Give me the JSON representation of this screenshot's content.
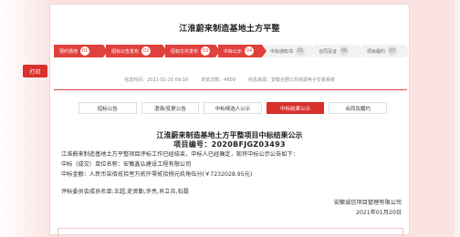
{
  "float_print_label": "打印",
  "page": {
    "title": "江淮蔚来制造基地土方平整"
  },
  "steps": [
    {
      "label": "预约场地",
      "num": "01",
      "state": "done"
    },
    {
      "label": "招标公告发布",
      "num": "02",
      "state": "done"
    },
    {
      "label": "招标文件发布",
      "num": "03",
      "state": "done"
    },
    {
      "label": "中标公示",
      "num": "04",
      "state": "done"
    },
    {
      "label": "中标通知书",
      "num": "05",
      "state": "todo"
    },
    {
      "label": "合同及证",
      "num": "06",
      "state": "todo"
    },
    {
      "label": "项目履约",
      "num": "07",
      "state": "todo"
    }
  ],
  "meta": {
    "time": "信息时间：2021-01-20 09:16",
    "views": "浏览次数：4809",
    "source": "信息来源：安徽合肥公共资源电子交易系统"
  },
  "tabs": [
    {
      "label": "招标公告",
      "active": false
    },
    {
      "label": "澄清/变更公告",
      "active": false
    },
    {
      "label": "中标候选人公示",
      "active": false
    },
    {
      "label": "中标结果公示",
      "active": true
    },
    {
      "label": "合同及履约",
      "active": false
    }
  ],
  "notice": {
    "title": "江淮蔚来制造基地土方平整项目中标结果公示",
    "code": "项目编号：2020BFJGZ03493",
    "intro": "江淮蔚来制造基地土方平整项目评标工作已经结束，中标人已经确定，现将中标公示公告如下：",
    "winner": "中标（成交）单位名称：安徽鑫弘建设工程有限公司",
    "amount": "中标金额：人民币柒佰贰拾叁万贰仟零贰拾捌元玖角伍分(￥7232028.95元)",
    "committee": "评标委员会成员名单:王超,史贤勤,许亮,肖立兵,石磊",
    "issuer": "安徽诚信项目管理有限公司",
    "date": "2021年01月20日"
  }
}
